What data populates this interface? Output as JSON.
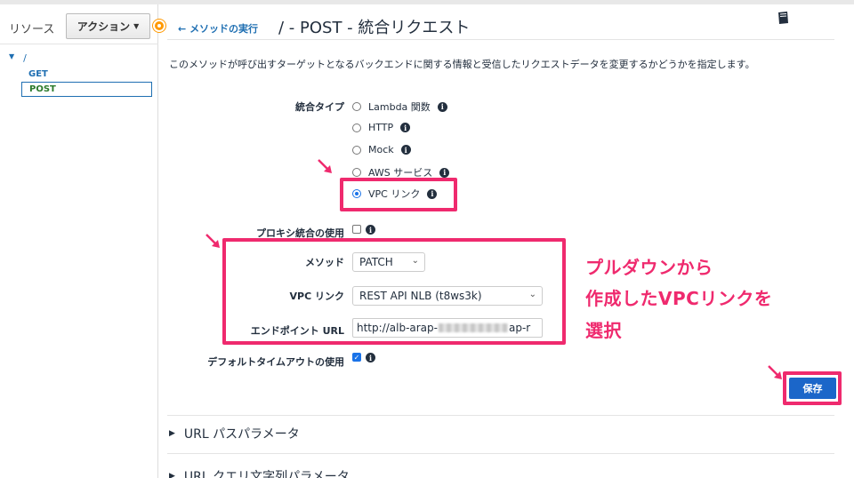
{
  "sidebar": {
    "resources_label": "リソース",
    "action_button": "アクション",
    "tree_root": "/",
    "method_get": "GET",
    "method_post": "POST"
  },
  "header": {
    "back_link": "メソッドの実行",
    "title": "/ - POST - 統合リクエスト",
    "description": "このメソッドが呼び出すターゲットとなるバックエンドに関する情報と受信したリクエストデータを変更するかどうかを指定します。"
  },
  "form": {
    "integration_type_label": "統合タイプ",
    "integration_options": [
      "Lambda 関数",
      "HTTP",
      "Mock",
      "AWS サービス",
      "VPC リンク"
    ],
    "selected_option_index": 4,
    "proxy_label": "プロキシ統合の使用",
    "proxy_checked": false,
    "method_label": "メソッド",
    "method_value": "PATCH",
    "vpc_link_label": "VPC リンク",
    "vpc_link_value": "REST API NLB (t8ws3k)",
    "endpoint_label": "エンドポイント URL",
    "endpoint_prefix": "http://alb-arap-",
    "endpoint_suffix": "ap-r",
    "timeout_label": "デフォルトタイムアウトの使用",
    "timeout_checked": true,
    "save_button": "保存"
  },
  "annotation": {
    "lines": [
      "プルダウンから",
      "作成したVPCリンクを",
      "選択"
    ],
    "color": "#ef2a6e"
  },
  "sections": [
    "URL パスパラメータ",
    "URL クエリ文字列パラメータ"
  ],
  "icons": [
    "book-icon",
    "info-icon",
    "arrow-left-icon",
    "caret-down-icon"
  ]
}
